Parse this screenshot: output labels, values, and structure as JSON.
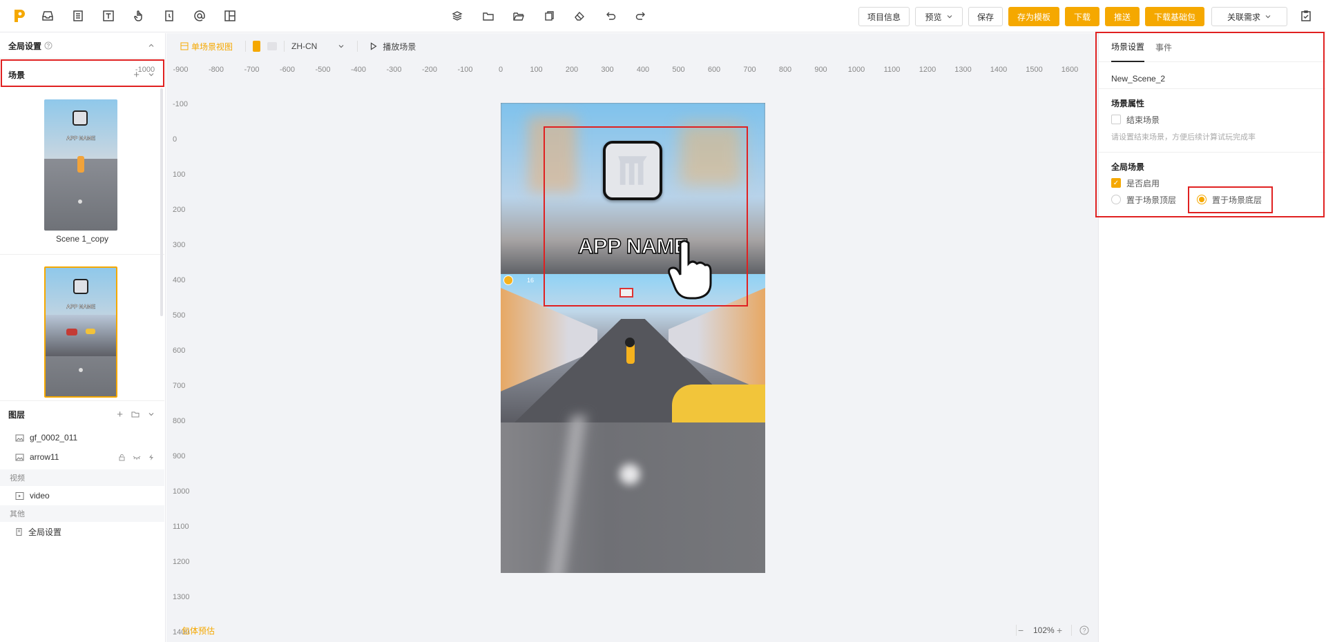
{
  "topbar": {
    "buttons": {
      "project_info": "项目信息",
      "preview": "预览",
      "save": "保存",
      "save_template": "存为模板",
      "download": "下载",
      "push": "推送",
      "download_base": "下载基础包",
      "related_demand": "关联需求"
    }
  },
  "left": {
    "global_settings": "全局设置",
    "scenes_title": "场景",
    "scenes": [
      {
        "name": "Scene 1_copy",
        "app_name": "APP NAME"
      },
      {
        "name": "",
        "app_name": "APP NAME"
      }
    ],
    "layers_title": "图层",
    "layers": [
      {
        "name": "gf_0002_011"
      },
      {
        "name": "arrow11"
      }
    ],
    "groups": {
      "video_title": "视频",
      "video_item": "video",
      "other_title": "其他",
      "other_item": "全局设置"
    }
  },
  "canvas": {
    "single_scene_view": "单场景视图",
    "language": "ZH-CN",
    "play_scene": "播放场景",
    "ruler_h": [
      "-1000",
      "-900",
      "-800",
      "-700",
      "-600",
      "-500",
      "-400",
      "-300",
      "-200",
      "-100",
      "0",
      "100",
      "200",
      "300",
      "400",
      "500",
      "600",
      "700",
      "800",
      "900",
      "1000",
      "1100",
      "1200",
      "1300",
      "1400",
      "1500",
      "1600"
    ],
    "ruler_v": [
      "-100",
      "0",
      "100",
      "200",
      "300",
      "400",
      "500",
      "600",
      "700",
      "800",
      "900",
      "1000",
      "1100",
      "1200",
      "1300",
      "1400"
    ],
    "app_name": "APP NAME",
    "hud_score": "16",
    "package_estimate": "包体预估",
    "zoom": "102%"
  },
  "right": {
    "tabs": [
      "场景设置",
      "事件"
    ],
    "scene_name": "New_Scene_2",
    "scene_props_title": "场景属性",
    "end_scene_label": "结束场景",
    "end_scene_checked": false,
    "hint": "请设置结束场景，方便后续计算试玩完成率",
    "global_scene_title": "全局场景",
    "enable_label": "是否启用",
    "enable_checked": true,
    "top_layer_label": "置于场景顶层",
    "bottom_layer_label": "置于场景底层",
    "selected_layer": "bottom"
  },
  "colors": {
    "accent": "#f5a800",
    "highlight": "#e02020"
  }
}
